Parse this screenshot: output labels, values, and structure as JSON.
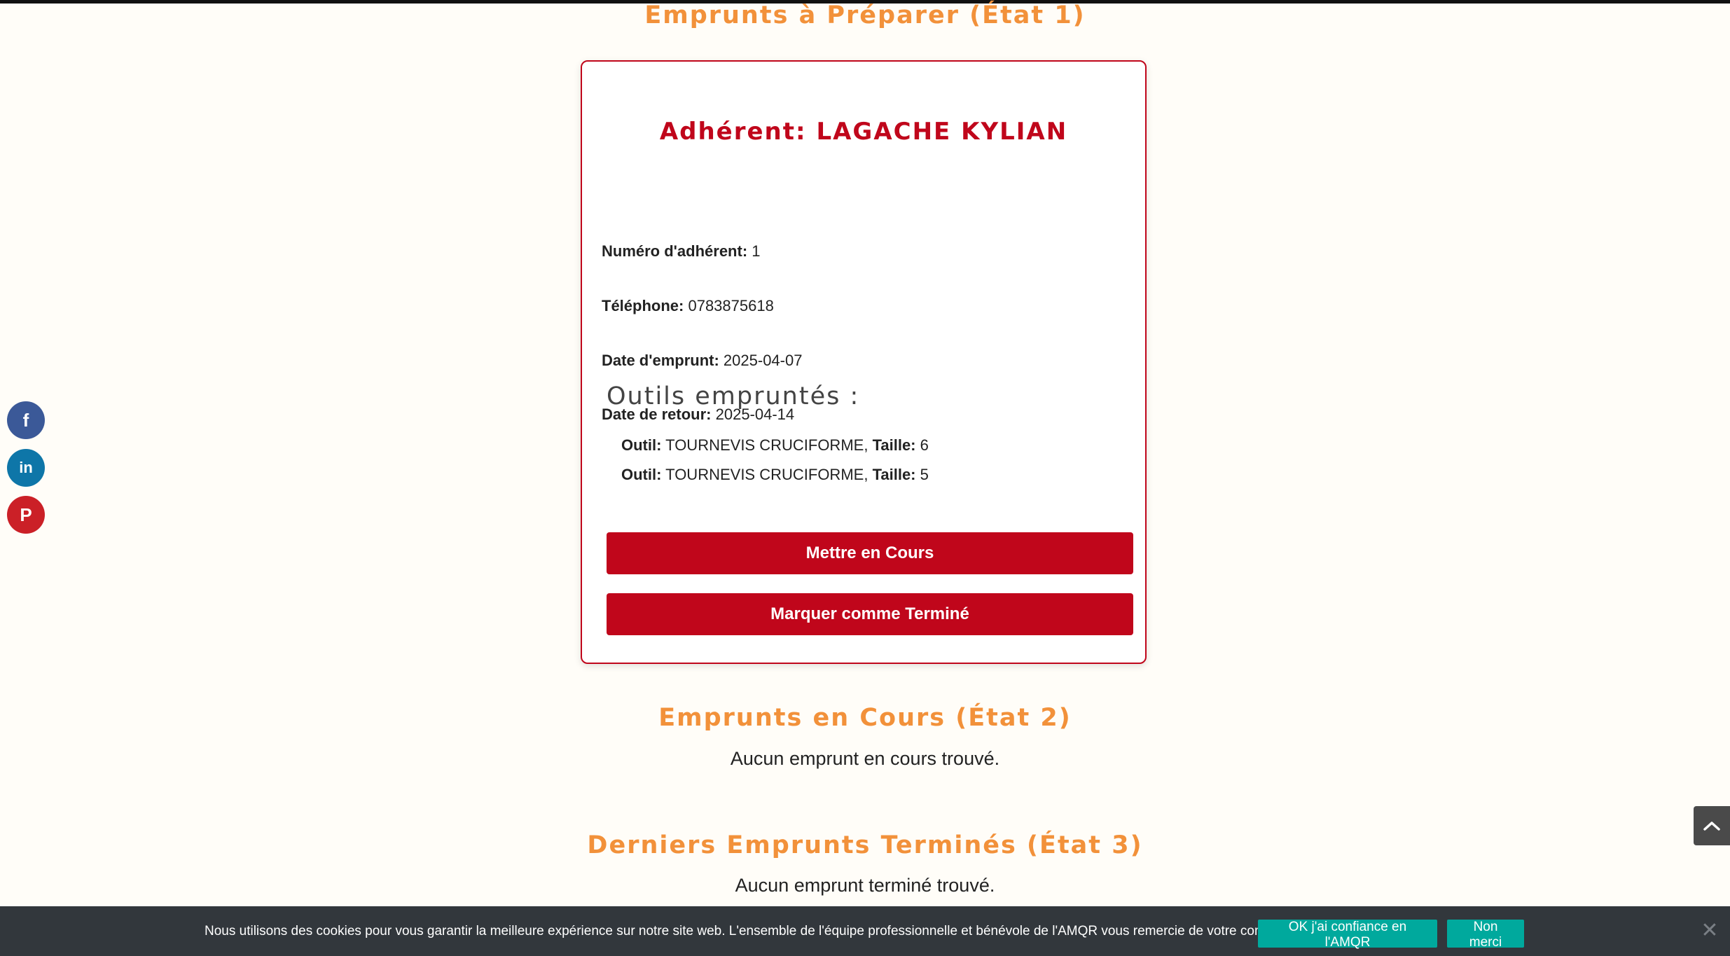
{
  "sections": {
    "preparer_title": "Emprunts à Préparer (État 1)",
    "encours_title": "Emprunts en Cours (État 2)",
    "encours_empty": "Aucun emprunt en cours trouvé.",
    "termines_title": "Derniers Emprunts Terminés (État 3)",
    "termines_empty": "Aucun emprunt terminé trouvé."
  },
  "loan": {
    "title": "Adhérent: LAGACHE KYLIAN",
    "fields": [
      {
        "label": "Numéro d'adhérent:",
        "value": "1"
      },
      {
        "label": "Téléphone:",
        "value": "0783875618"
      },
      {
        "label": "Date d'emprunt:",
        "value": "2025-04-07"
      },
      {
        "label": "Date de retour:",
        "value": "2025-04-14"
      }
    ],
    "tools_title": "Outils empruntés :",
    "tool_label": "Outil:",
    "size_label": "Taille:",
    "tools": [
      {
        "name": "TOURNEVIS CRUCIFORME,",
        "size": "6"
      },
      {
        "name": "TOURNEVIS CRUCIFORME,",
        "size": "5"
      }
    ],
    "btn_en_cours": "Mettre en Cours",
    "btn_termine": "Marquer comme Terminé"
  },
  "social": {
    "facebook": "f",
    "linkedin": "in",
    "pinterest": "P"
  },
  "cookie": {
    "text": "Nous utilisons des cookies pour vous garantir la meilleure expérience sur notre site web. L'ensemble de l'équipe professionnelle et bénévole de l'AMQR vous remercie de votre compréhension.",
    "ok_label": "OK j'ai confiance en l'AMQR",
    "no_label": "Non merci",
    "close": "✕"
  },
  "icons": {
    "back_to_top": "chevron-up-icon",
    "facebook": "facebook-icon",
    "linkedin": "linkedin-icon",
    "pinterest": "pinterest-icon",
    "close": "close-icon"
  },
  "colors": {
    "accent_red": "#c0061b",
    "section_orange": "#f2913a",
    "cookie_green": "#00a99d",
    "cookie_bar": "#32373c"
  }
}
